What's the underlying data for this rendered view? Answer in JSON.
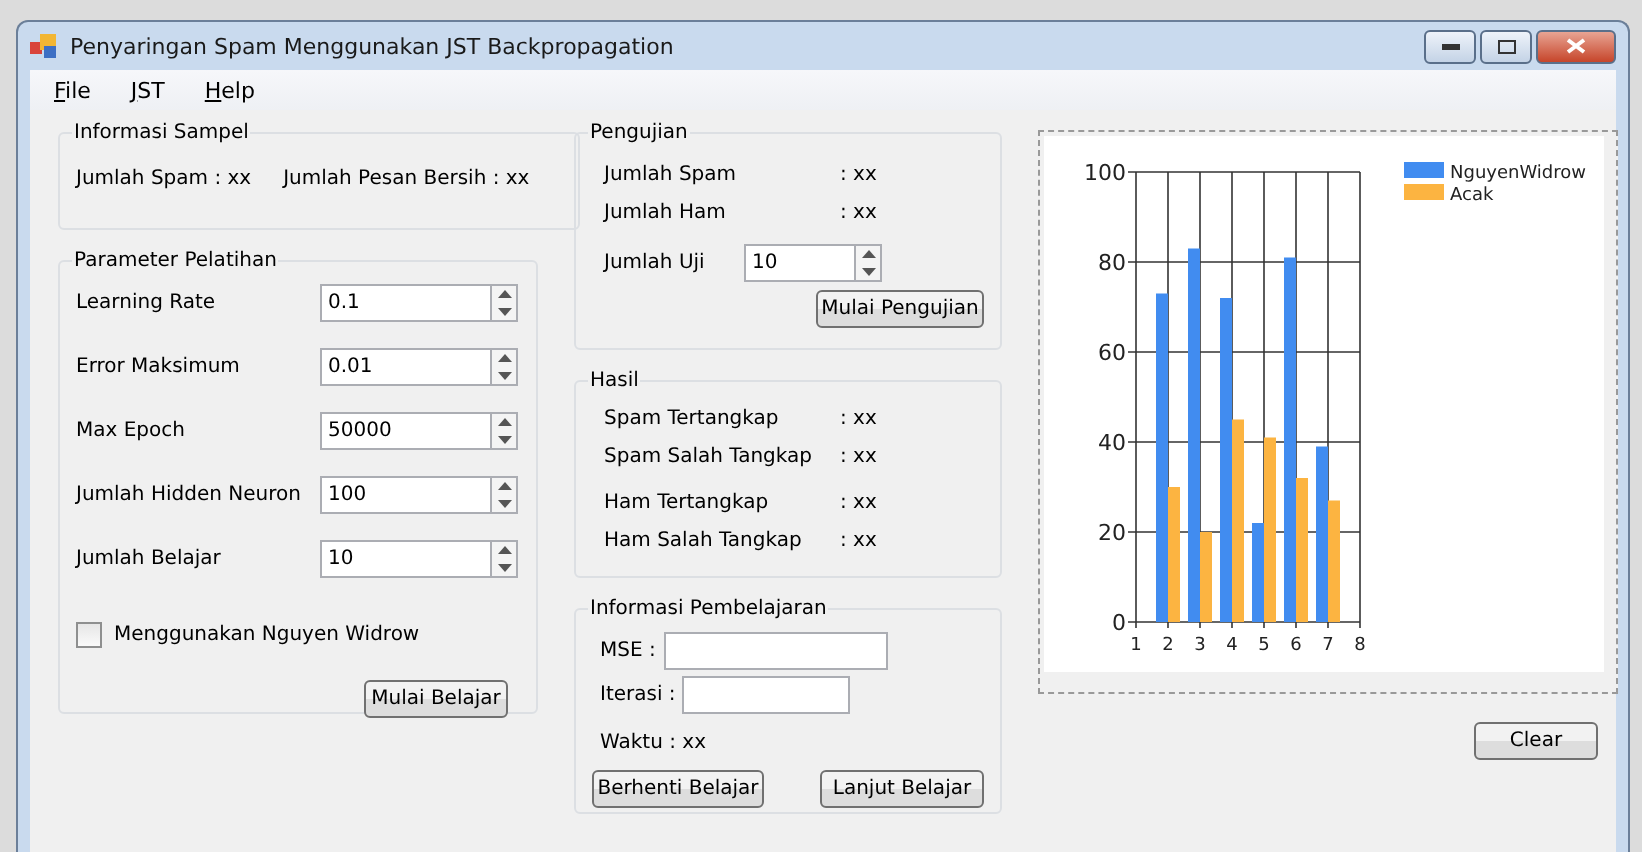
{
  "window": {
    "title": "Penyaringan Spam Menggunakan JST Backpropagation"
  },
  "menu": [
    {
      "label": "File"
    },
    {
      "label": "JST"
    },
    {
      "label": "Help"
    }
  ],
  "sample_info": {
    "title": "Informasi Sampel",
    "texts": [
      "Jumlah Spam : xx",
      "Jumlah Pesan Bersih : xx"
    ]
  },
  "training_params": {
    "title": "Parameter Pelatihan",
    "fields": [
      {
        "label": "Learning Rate",
        "value": "0.1"
      },
      {
        "label": "Error Maksimum",
        "value": "0.01"
      },
      {
        "label": "Max Epoch",
        "value": "50000"
      },
      {
        "label": "Jumlah Hidden Neuron",
        "value": "100"
      },
      {
        "label": "Jumlah Belajar",
        "value": "10"
      }
    ],
    "checkbox": {
      "label": "Menggunakan Nguyen Widrow",
      "checked": false
    },
    "button": "Mulai Belajar"
  },
  "testing": {
    "title": "Pengujian",
    "rows": [
      {
        "label": "Jumlah Spam",
        "value": ": xx"
      },
      {
        "label": "Jumlah Ham",
        "value": ": xx"
      }
    ],
    "field": {
      "label": "Jumlah Uji",
      "value": "10"
    },
    "button": "Mulai Pengujian"
  },
  "results": {
    "title": "Hasil",
    "rows": [
      {
        "label": "Spam Tertangkap",
        "value": ": xx"
      },
      {
        "label": "Spam Salah Tangkap",
        "value": ": xx"
      },
      {
        "label": "Ham Tertangkap",
        "value": ": xx"
      },
      {
        "label": "Ham Salah Tangkap",
        "value": ": xx"
      }
    ]
  },
  "learning_info": {
    "title": "Informasi Pembelajaran",
    "mse_label": "MSE  :",
    "iteration_label": "Iterasi :",
    "time": "Waktu : xx",
    "buttons": [
      "Berhenti Belajar",
      "Lanjut Belajar"
    ]
  },
  "chart": {
    "chart_data": {
      "type": "bar",
      "x": [
        2,
        3,
        4,
        5,
        6,
        7
      ],
      "series": [
        {
          "name": "NguyenWidrow",
          "color": "#418cf0",
          "values": [
            73,
            83,
            72,
            22,
            81,
            39
          ]
        },
        {
          "name": "Acak",
          "color": "#fcb441",
          "values": [
            30,
            20,
            45,
            41,
            32,
            27
          ]
        }
      ],
      "grid": true,
      "legend": true,
      "xlim": [
        1,
        8
      ],
      "ylim": [
        0,
        100
      ],
      "xticks": [
        1,
        2,
        3,
        4,
        5,
        6,
        7,
        8
      ],
      "yticks": [
        0,
        20,
        40,
        60,
        80,
        100
      ]
    }
  },
  "clear_button": "Clear"
}
